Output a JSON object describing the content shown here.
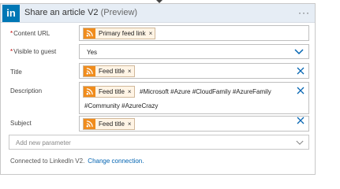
{
  "card": {
    "logo_text": "in",
    "title": "Share an article V2",
    "preview": "(Preview)",
    "menu_glyph": "···",
    "brand_color": "#0077b5"
  },
  "fields": {
    "content_url": {
      "required_mark": "*",
      "label": "Content URL",
      "token": "Primary feed link"
    },
    "visible_to_guest": {
      "required_mark": "*",
      "label": "Visible to guest",
      "value": "Yes"
    },
    "title": {
      "label": "Title",
      "token": "Feed title"
    },
    "description": {
      "label": "Description",
      "token": "Feed title",
      "text_line1": "#Microsoft #Azure #CloudFamily #AzureFamily",
      "text_line2": "#Community #AzureCrazy"
    },
    "subject": {
      "label": "Subject",
      "token": "Feed title"
    }
  },
  "add_parameter": {
    "placeholder": "Add new parameter"
  },
  "footer": {
    "connected_text": "Connected to LinkedIn V2.",
    "change_link": "Change connection."
  },
  "icons": {
    "token_icon": "rss-icon",
    "token_remove": "close-icon",
    "field_clear": "close-icon",
    "dropdown": "chevron-down-icon",
    "accent_color": "#f08c1c"
  }
}
